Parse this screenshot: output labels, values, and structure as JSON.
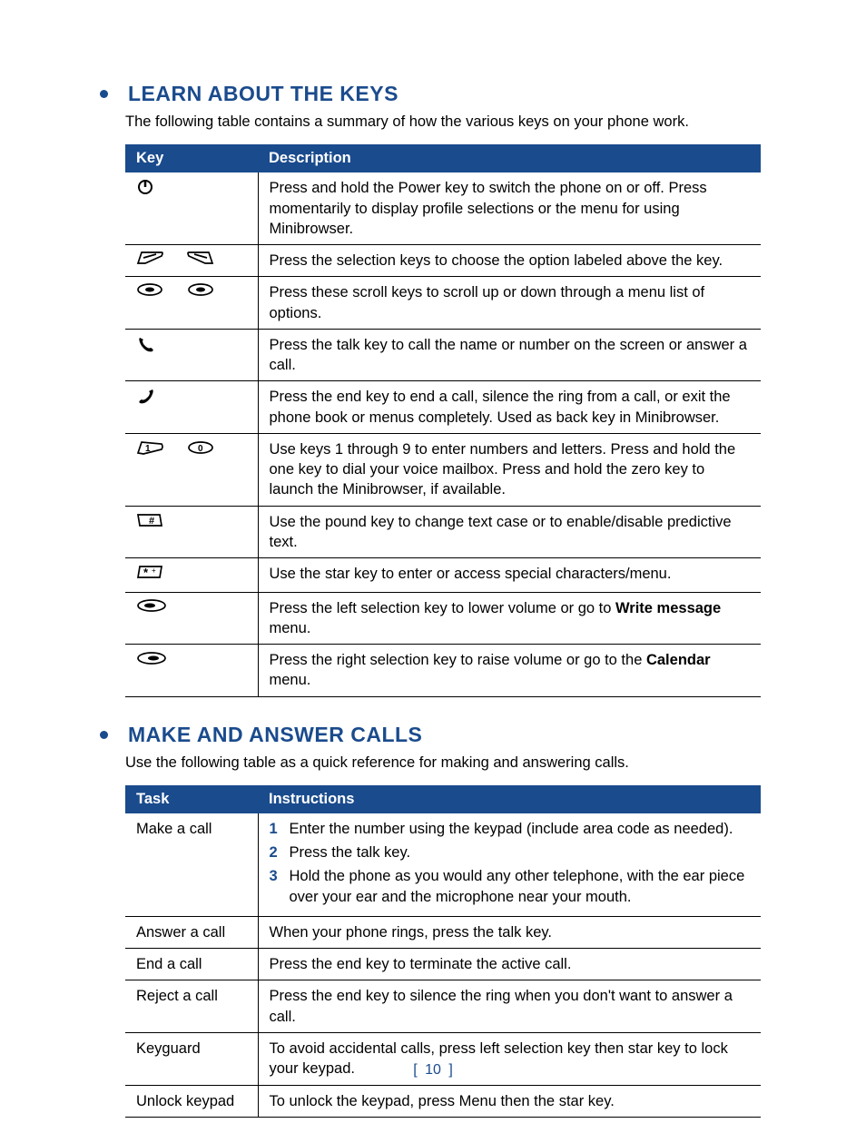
{
  "section1": {
    "title": "LEARN ABOUT THE KEYS",
    "intro": "The following table contains a summary of how the various keys on your phone work.",
    "headers": {
      "key": "Key",
      "desc": "Description"
    },
    "rows": [
      {
        "icon": "power-icon",
        "desc": "Press and hold the Power key to switch the phone on or off. Press momentarily to display profile selections or the menu for using Minibrowser."
      },
      {
        "icon": "selection-keys-icon",
        "desc": "Press the selection keys to choose the option labeled above the key."
      },
      {
        "icon": "scroll-keys-icon",
        "desc": "Press these scroll keys to scroll up or down through a menu list of options."
      },
      {
        "icon": "talk-key-icon",
        "desc": "Press the talk key to call the name or number on the screen or answer a call."
      },
      {
        "icon": "end-key-icon",
        "desc": "Press the end key to end a call, silence the ring from a call, or exit the phone book or menus completely. Used as back key in Minibrowser."
      },
      {
        "icon": "number-keys-icon",
        "desc": "Use keys 1 through 9 to enter numbers and letters. Press and hold the one key to dial your voice mailbox. Press and hold the zero key to launch the Minibrowser, if available."
      },
      {
        "icon": "pound-key-icon",
        "desc": "Use the pound key to change text case or to enable/disable predictive text."
      },
      {
        "icon": "star-key-icon",
        "desc": "Use the star key to enter or access special characters/menu."
      },
      {
        "icon": "left-selection-key-icon",
        "desc_pre": "Press the left selection key to lower volume or go to ",
        "bold": "Write message",
        "desc_post": " menu."
      },
      {
        "icon": "right-selection-key-icon",
        "desc_pre": "Press the right selection key to raise volume or go to the ",
        "bold": "Calendar",
        "desc_post": " menu."
      }
    ]
  },
  "section2": {
    "title": "MAKE AND ANSWER CALLS",
    "intro": "Use the following table as a quick reference for making and answering calls.",
    "headers": {
      "task": "Task",
      "instr": "Instructions"
    },
    "rows": [
      {
        "task": "Make a call",
        "steps": [
          "Enter the number using the keypad (include area code as needed).",
          "Press the talk key.",
          "Hold the phone as you would any other telephone, with the ear piece over your ear and the microphone near your mouth."
        ]
      },
      {
        "task": "Answer a call",
        "instr": "When your phone rings, press the talk key."
      },
      {
        "task": "End a call",
        "instr": "Press the end key to terminate the active call."
      },
      {
        "task": "Reject a call",
        "instr": "Press the end key to silence the ring when you don't want to answer a call."
      },
      {
        "task": "Keyguard",
        "instr": "To avoid accidental calls, press left selection key then star key to lock your keypad."
      },
      {
        "task": "Unlock keypad",
        "instr": "To unlock the keypad, press Menu then the star key."
      }
    ]
  },
  "page_number": "10"
}
